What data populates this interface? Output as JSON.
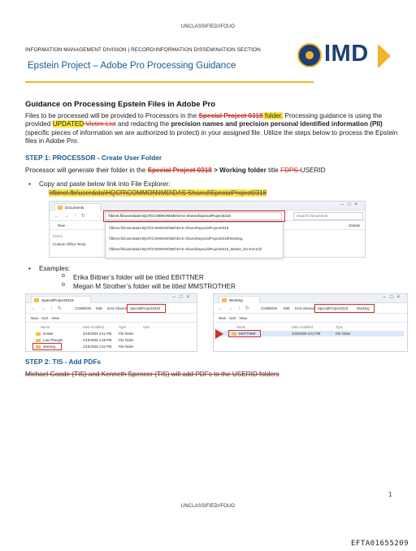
{
  "classification": {
    "top": "UNCLASSIFIED//FOUO",
    "bottom": "UNCLASSIFIED//FOUO"
  },
  "header": {
    "division_line": "INFORMATION MANAGEMENT DIVISION  |  RECORD/INFORMATION DISSEMINATION SECTION",
    "subtitle": "Epstein Project – Adobe Pro Processing Guidance",
    "logo_text": "IMD",
    "colors": {
      "navy": "#1e3f75",
      "gold": "#f0b429",
      "blue_text": "#1a5a8f"
    }
  },
  "body": {
    "heading": "Guidance on Processing Epstein Files in Adobe Pro",
    "intro": {
      "p1": "Files to be processed will be provided to Processors in the ",
      "p2": "Special Project 0318",
      "p3": " folder.",
      "p4": " Processing guidance is using the provided ",
      "p5": "UPDATED",
      "p6": " Victim List",
      "p7": " and redacting the ",
      "p8": "precision names and precision personal identified information (PII)",
      "p9": " (specific pieces of information we are authorized to protect) in your assigned file. Utilize the steps below to process the Epstein files in Adobe Pro."
    },
    "step1": {
      "title": "STEP 1: PROCESSOR - Create User Folder",
      "t1": "Processor will generate their folder in the ",
      "t2": "Special Project 0318",
      "t3": " > Working folder",
      "t4": " title ",
      "t5": "FDPS-",
      "t6": "USERID",
      "copy_instruction": "Copy and paste below link into File Explorer:",
      "copy_path": "\\\\fbinet.fbi\\userdata\\HQCR\\COMMON\\IMD\\DAS Shared\\SpecialProject0318",
      "examples_label": "Examples:",
      "example1": "Erika Bittner’s folder will be titled EBITTNER",
      "example2": "Megan M Strother’s folder will be titled MMSTROTHER"
    },
    "step2": {
      "title": "STEP 2: TIS - Add PDFs",
      "text": "Michael Goode (TIS) and Kenneth Spencer (TIS) will add PDFs to the USERID folders"
    }
  },
  "screenshot1": {
    "tab": "Documents",
    "address": "\\\\fbinet.fbi\\userdata\\HQCR\\COMMON\\IMD\\DAS Shared\\SpecialProject0318",
    "search_placeholder": "Search Documents",
    "new_label": "New",
    "details_label": "Details",
    "left_items": [
      "Name",
      "Custom Office Temp"
    ],
    "suggestions": [
      "\\\\fbinet.fbi\\userdata\\HQCR\\COMMON\\IMD\\DAS Shared\\SpecialProject0318",
      "\\\\fbinet.fbi\\userdata\\HQCR\\COMMON\\IMD\\DAS Shared\\SpecialProject0318\\Working",
      "\\\\fbinet.fbi\\userdata\\HQCR\\COMMON\\IMD\\DAS Shared\\SpecialProject0318_Master_Do Not Edit"
    ]
  },
  "screenshot2": {
    "tab": "SpecialProject0318",
    "crumbs": [
      "COMMON",
      "IMD",
      "DAS Shared",
      "SpecialProject0318"
    ],
    "toolbar": "New  ·  Sort  ·  View",
    "columns": [
      "Name",
      "Date modified",
      "Type",
      "Size"
    ],
    "rows": [
      {
        "name": "Isolate",
        "date": "2/19/2025 4:41 PM",
        "type": "File folder"
      },
      {
        "name": "Last Thought",
        "date": "2/19/2025 1:48 PM",
        "type": "File folder"
      },
      {
        "name": "Working",
        "date": "2/19/2025 1:52 PM",
        "type": "File folder"
      }
    ]
  },
  "screenshot3": {
    "tab": "Working",
    "crumbs": [
      "COMMON",
      "IMD",
      "DAS Shared",
      "SpecialProject0318",
      "Working"
    ],
    "toolbar": "New  ·  Sort  ·  View",
    "columns": [
      "Name",
      "Date modified",
      "Type"
    ],
    "rows": [
      {
        "name": "EBITTNER",
        "date": "2/20/2025 3:41 PM",
        "type": "File folder"
      }
    ]
  },
  "footer": {
    "page_number": "1",
    "doc_id": "EFTA01655209"
  }
}
